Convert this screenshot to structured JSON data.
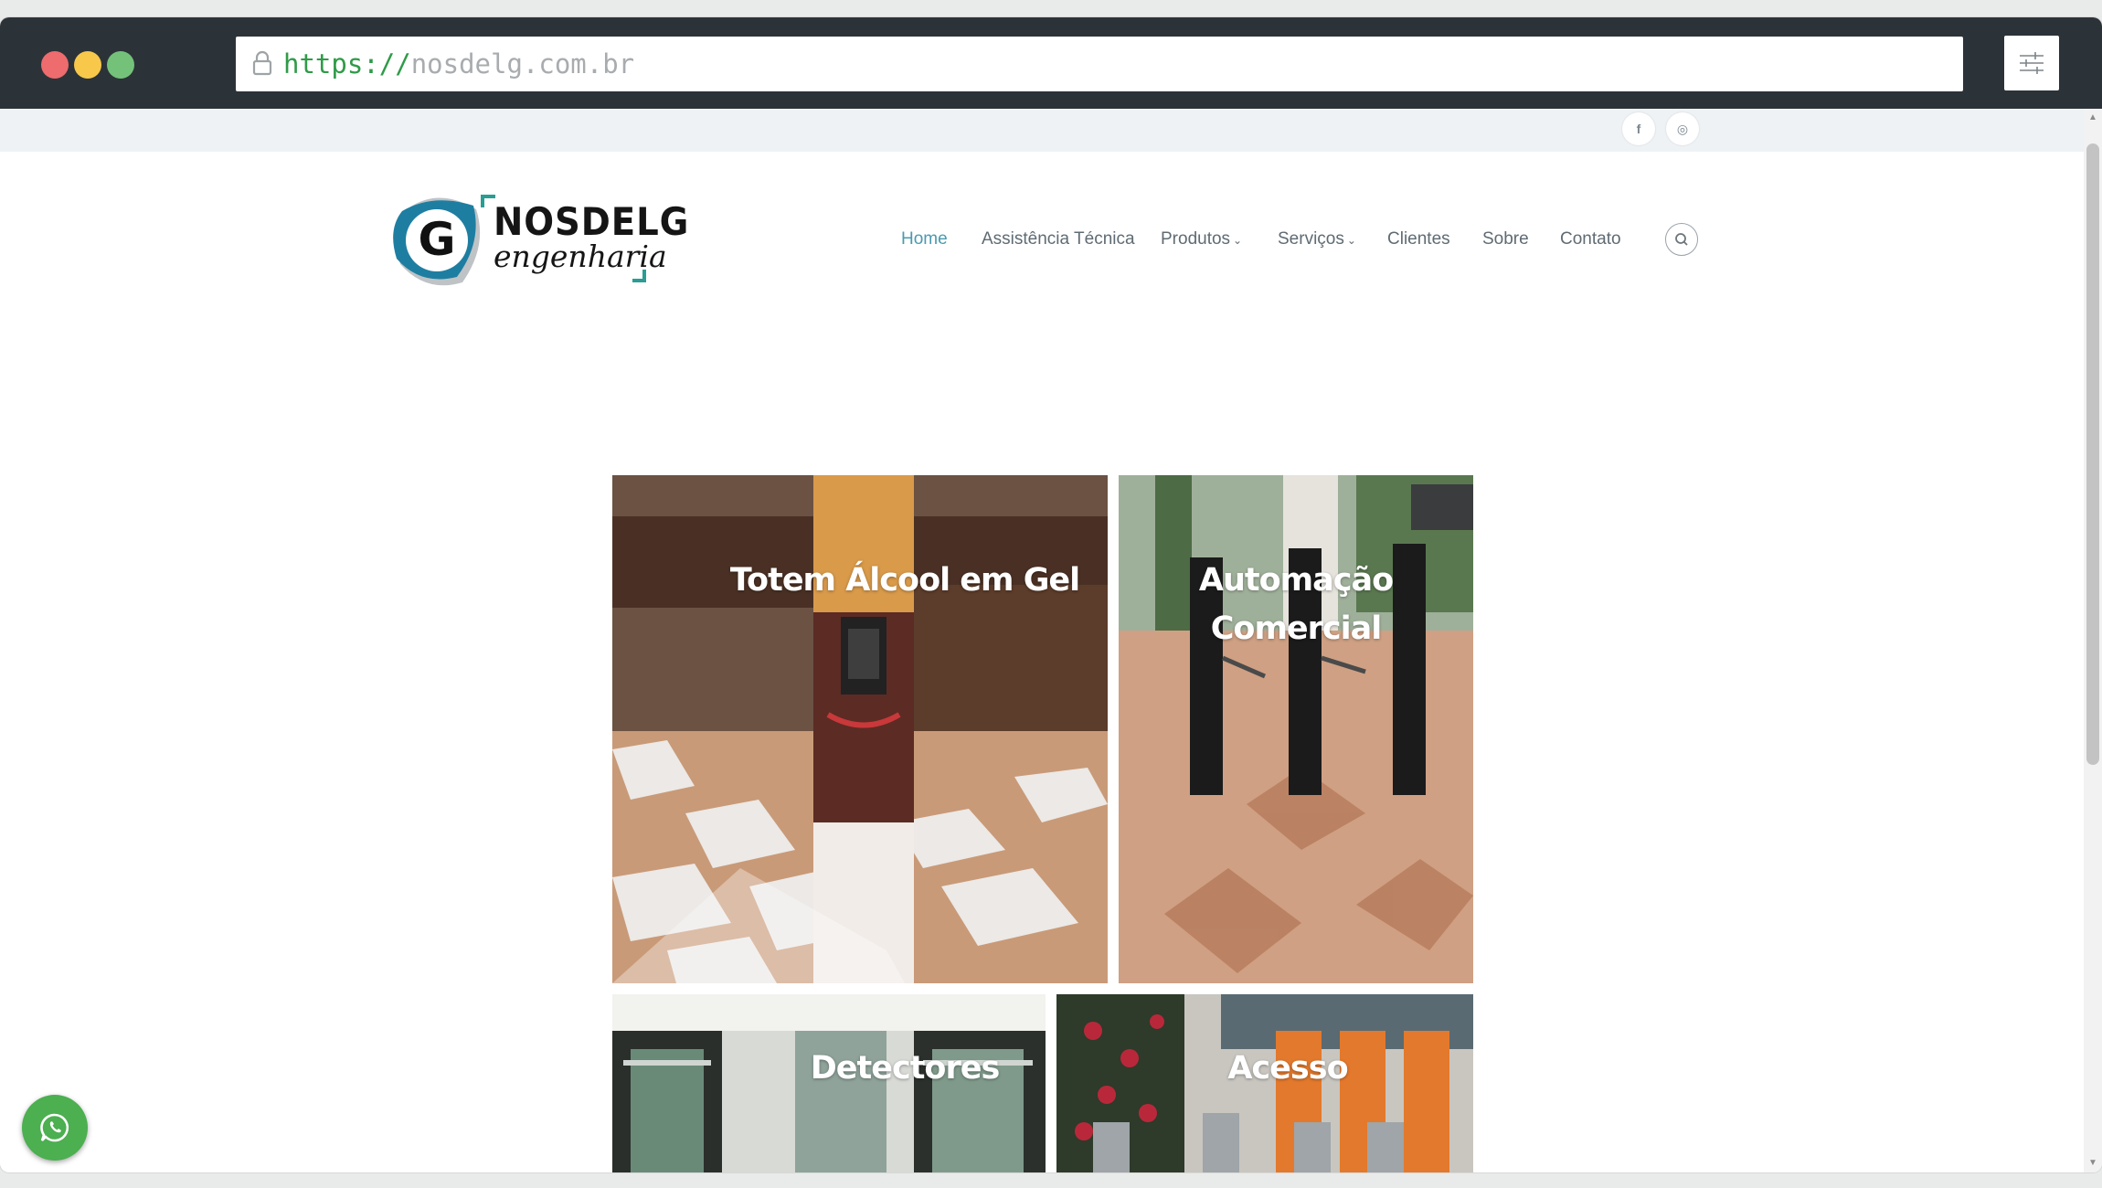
{
  "browser": {
    "url_scheme": "https://",
    "url_host": "nosdelg.com.br",
    "traffic_lights": [
      "#ee6b6e",
      "#f7c84a",
      "#74c27a"
    ],
    "lock_icon": "lock-icon",
    "menu_icon": "sliders-icon"
  },
  "topbar": {
    "social": [
      {
        "name": "facebook",
        "glyph": "f"
      },
      {
        "name": "instagram",
        "glyph": "◎"
      }
    ]
  },
  "header": {
    "logo": {
      "brand": "NOSDELG",
      "sub": "engenharia",
      "mark_letter": "G"
    },
    "nav": [
      {
        "label": "Home",
        "active": true,
        "dropdown": false
      },
      {
        "label": "Assistência Técnica",
        "active": false,
        "dropdown": false
      },
      {
        "label": "Produtos",
        "active": false,
        "dropdown": true
      },
      {
        "label": "Serviços",
        "active": false,
        "dropdown": true
      },
      {
        "label": "Clientes",
        "active": false,
        "dropdown": false
      },
      {
        "label": "Sobre",
        "active": false,
        "dropdown": false
      },
      {
        "label": "Contato",
        "active": false,
        "dropdown": false
      }
    ],
    "dropdown_caret": "⌄",
    "search_icon": "search-icon"
  },
  "tiles": [
    {
      "title_lines": [
        "Totem Álcool em Gel"
      ]
    },
    {
      "title_lines": [
        "Automação",
        "Comercial"
      ]
    },
    {
      "title_lines": [
        "Detectores"
      ]
    },
    {
      "title_lines": [
        "Acesso"
      ]
    }
  ],
  "colors": {
    "accent": "#4b9ab0",
    "nav_text": "#5f6b73",
    "whatsapp": "#4caf50"
  },
  "floating": {
    "whatsapp_icon": "whatsapp-icon"
  }
}
